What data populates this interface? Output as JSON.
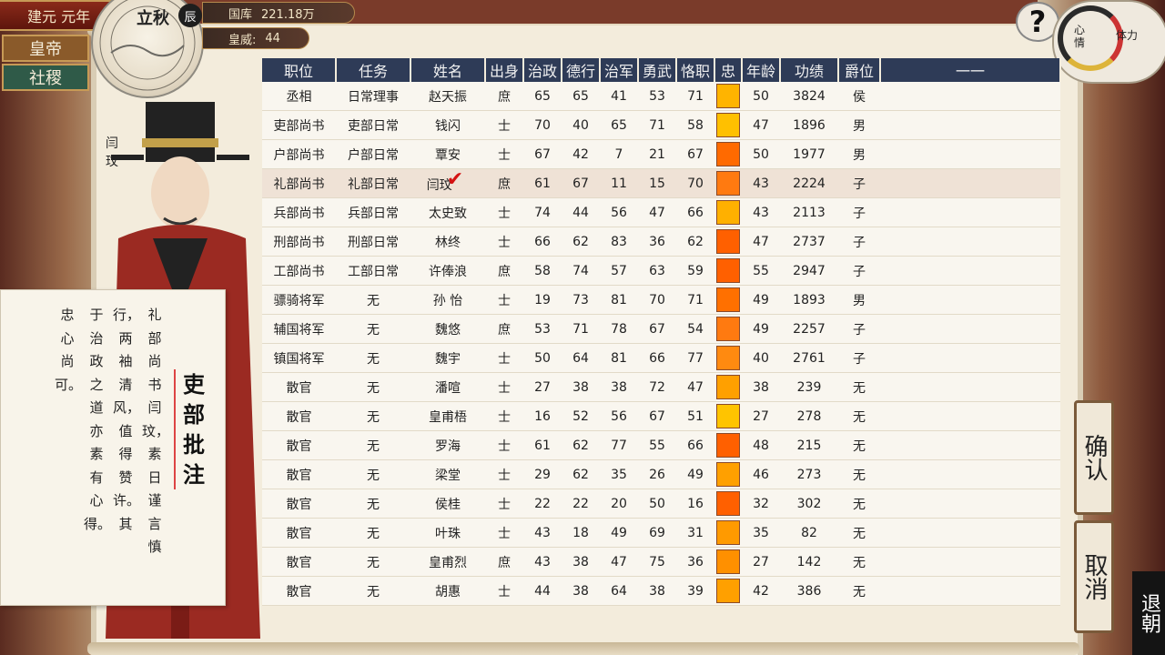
{
  "header": {
    "era": "建元 元年",
    "nav": [
      "皇帝",
      "社稷"
    ],
    "treasury_label": "国库",
    "treasury_value": "221.18万",
    "prestige_label": "皇威:",
    "prestige_value": "44",
    "season": "立秋",
    "hour": "辰"
  },
  "mood": {
    "label1": "心情",
    "label2": "体力"
  },
  "help_icon": "?",
  "portrait": {
    "name": "闫玟"
  },
  "comment": {
    "title": "吏部批注",
    "columns": [
      "礼部尚书闫玟，素日谨言慎",
      "行，两袖清风，值得赞许。其",
      "于治政之道亦素有心得。",
      "忠心尚可。"
    ]
  },
  "table": {
    "columns": [
      "职位",
      "任务",
      "姓名",
      "出身",
      "治政",
      "德行",
      "治军",
      "勇武",
      "恪职",
      "忠",
      "年龄",
      "功绩",
      "爵位",
      "一一"
    ],
    "rows": [
      {
        "post": "丞相",
        "task": "日常理事",
        "name": "赵天振",
        "origin": "庶",
        "admin": "65",
        "virtue": "65",
        "military": "41",
        "valor": "53",
        "diligence": "71",
        "loyalty_color": "#ffb400",
        "age": "50",
        "merit": "3824",
        "rank": "侯"
      },
      {
        "post": "吏部尚书",
        "task": "吏部日常",
        "name": "钱闪",
        "origin": "士",
        "admin": "70",
        "virtue": "40",
        "military": "65",
        "valor": "71",
        "diligence": "58",
        "loyalty_color": "#ffc000",
        "age": "47",
        "merit": "1896",
        "rank": "男"
      },
      {
        "post": "户部尚书",
        "task": "户部日常",
        "name": "覃安",
        "origin": "士",
        "admin": "67",
        "virtue": "42",
        "military": "7",
        "valor": "21",
        "diligence": "67",
        "loyalty_color": "#ff6a00",
        "age": "50",
        "merit": "1977",
        "rank": "男"
      },
      {
        "post": "礼部尚书",
        "task": "礼部日常",
        "name": "闫玟",
        "origin": "庶",
        "admin": "61",
        "virtue": "67",
        "military": "11",
        "valor": "15",
        "diligence": "70",
        "loyalty_color": "#ff7a10",
        "age": "43",
        "merit": "2224",
        "rank": "子"
      },
      {
        "post": "兵部尚书",
        "task": "兵部日常",
        "name": "太史致",
        "origin": "士",
        "admin": "74",
        "virtue": "44",
        "military": "56",
        "valor": "47",
        "diligence": "66",
        "loyalty_color": "#ffb000",
        "age": "43",
        "merit": "2113",
        "rank": "子"
      },
      {
        "post": "刑部尚书",
        "task": "刑部日常",
        "name": "林终",
        "origin": "士",
        "admin": "66",
        "virtue": "62",
        "military": "83",
        "valor": "36",
        "diligence": "62",
        "loyalty_color": "#ff6000",
        "age": "47",
        "merit": "2737",
        "rank": "子"
      },
      {
        "post": "工部尚书",
        "task": "工部日常",
        "name": "许俸浪",
        "origin": "庶",
        "admin": "58",
        "virtue": "74",
        "military": "57",
        "valor": "63",
        "diligence": "59",
        "loyalty_color": "#ff6000",
        "age": "55",
        "merit": "2947",
        "rank": "子"
      },
      {
        "post": "骠骑将军",
        "task": "无",
        "name": "孙 怡",
        "origin": "士",
        "admin": "19",
        "virtue": "73",
        "military": "81",
        "valor": "70",
        "diligence": "71",
        "loyalty_color": "#ff7000",
        "age": "49",
        "merit": "1893",
        "rank": "男"
      },
      {
        "post": "辅国将军",
        "task": "无",
        "name": "魏悠",
        "origin": "庶",
        "admin": "53",
        "virtue": "71",
        "military": "78",
        "valor": "67",
        "diligence": "54",
        "loyalty_color": "#ff7a10",
        "age": "49",
        "merit": "2257",
        "rank": "子"
      },
      {
        "post": "镇国将军",
        "task": "无",
        "name": "魏宇",
        "origin": "士",
        "admin": "50",
        "virtue": "64",
        "military": "81",
        "valor": "66",
        "diligence": "77",
        "loyalty_color": "#ff8a10",
        "age": "40",
        "merit": "2761",
        "rank": "子"
      },
      {
        "post": "散官",
        "task": "无",
        "name": "潘喧",
        "origin": "士",
        "admin": "27",
        "virtue": "38",
        "military": "38",
        "valor": "72",
        "diligence": "47",
        "loyalty_color": "#ffa000",
        "age": "38",
        "merit": "239",
        "rank": "无"
      },
      {
        "post": "散官",
        "task": "无",
        "name": "皇甫梧",
        "origin": "士",
        "admin": "16",
        "virtue": "52",
        "military": "56",
        "valor": "67",
        "diligence": "51",
        "loyalty_color": "#ffc400",
        "age": "27",
        "merit": "278",
        "rank": "无"
      },
      {
        "post": "散官",
        "task": "无",
        "name": "罗海",
        "origin": "士",
        "admin": "61",
        "virtue": "62",
        "military": "77",
        "valor": "55",
        "diligence": "66",
        "loyalty_color": "#ff6000",
        "age": "48",
        "merit": "215",
        "rank": "无"
      },
      {
        "post": "散官",
        "task": "无",
        "name": "梁堂",
        "origin": "士",
        "admin": "29",
        "virtue": "62",
        "military": "35",
        "valor": "26",
        "diligence": "49",
        "loyalty_color": "#ffa000",
        "age": "46",
        "merit": "273",
        "rank": "无"
      },
      {
        "post": "散官",
        "task": "无",
        "name": "侯桂",
        "origin": "士",
        "admin": "22",
        "virtue": "22",
        "military": "20",
        "valor": "50",
        "diligence": "16",
        "loyalty_color": "#ff6000",
        "age": "32",
        "merit": "302",
        "rank": "无"
      },
      {
        "post": "散官",
        "task": "无",
        "name": "叶珠",
        "origin": "士",
        "admin": "43",
        "virtue": "18",
        "military": "49",
        "valor": "69",
        "diligence": "31",
        "loyalty_color": "#ff9a00",
        "age": "35",
        "merit": "82",
        "rank": "无"
      },
      {
        "post": "散官",
        "task": "无",
        "name": "皇甫烈",
        "origin": "庶",
        "admin": "43",
        "virtue": "38",
        "military": "47",
        "valor": "75",
        "diligence": "36",
        "loyalty_color": "#ff9000",
        "age": "27",
        "merit": "142",
        "rank": "无"
      },
      {
        "post": "散官",
        "task": "无",
        "name": "胡惠",
        "origin": "士",
        "admin": "44",
        "virtue": "38",
        "military": "64",
        "valor": "38",
        "diligence": "39",
        "loyalty_color": "#ffa000",
        "age": "42",
        "merit": "386",
        "rank": "无"
      }
    ],
    "selected_row": 3
  },
  "buttons": {
    "confirm": "确认",
    "cancel": "取消",
    "exit": "退朝"
  }
}
